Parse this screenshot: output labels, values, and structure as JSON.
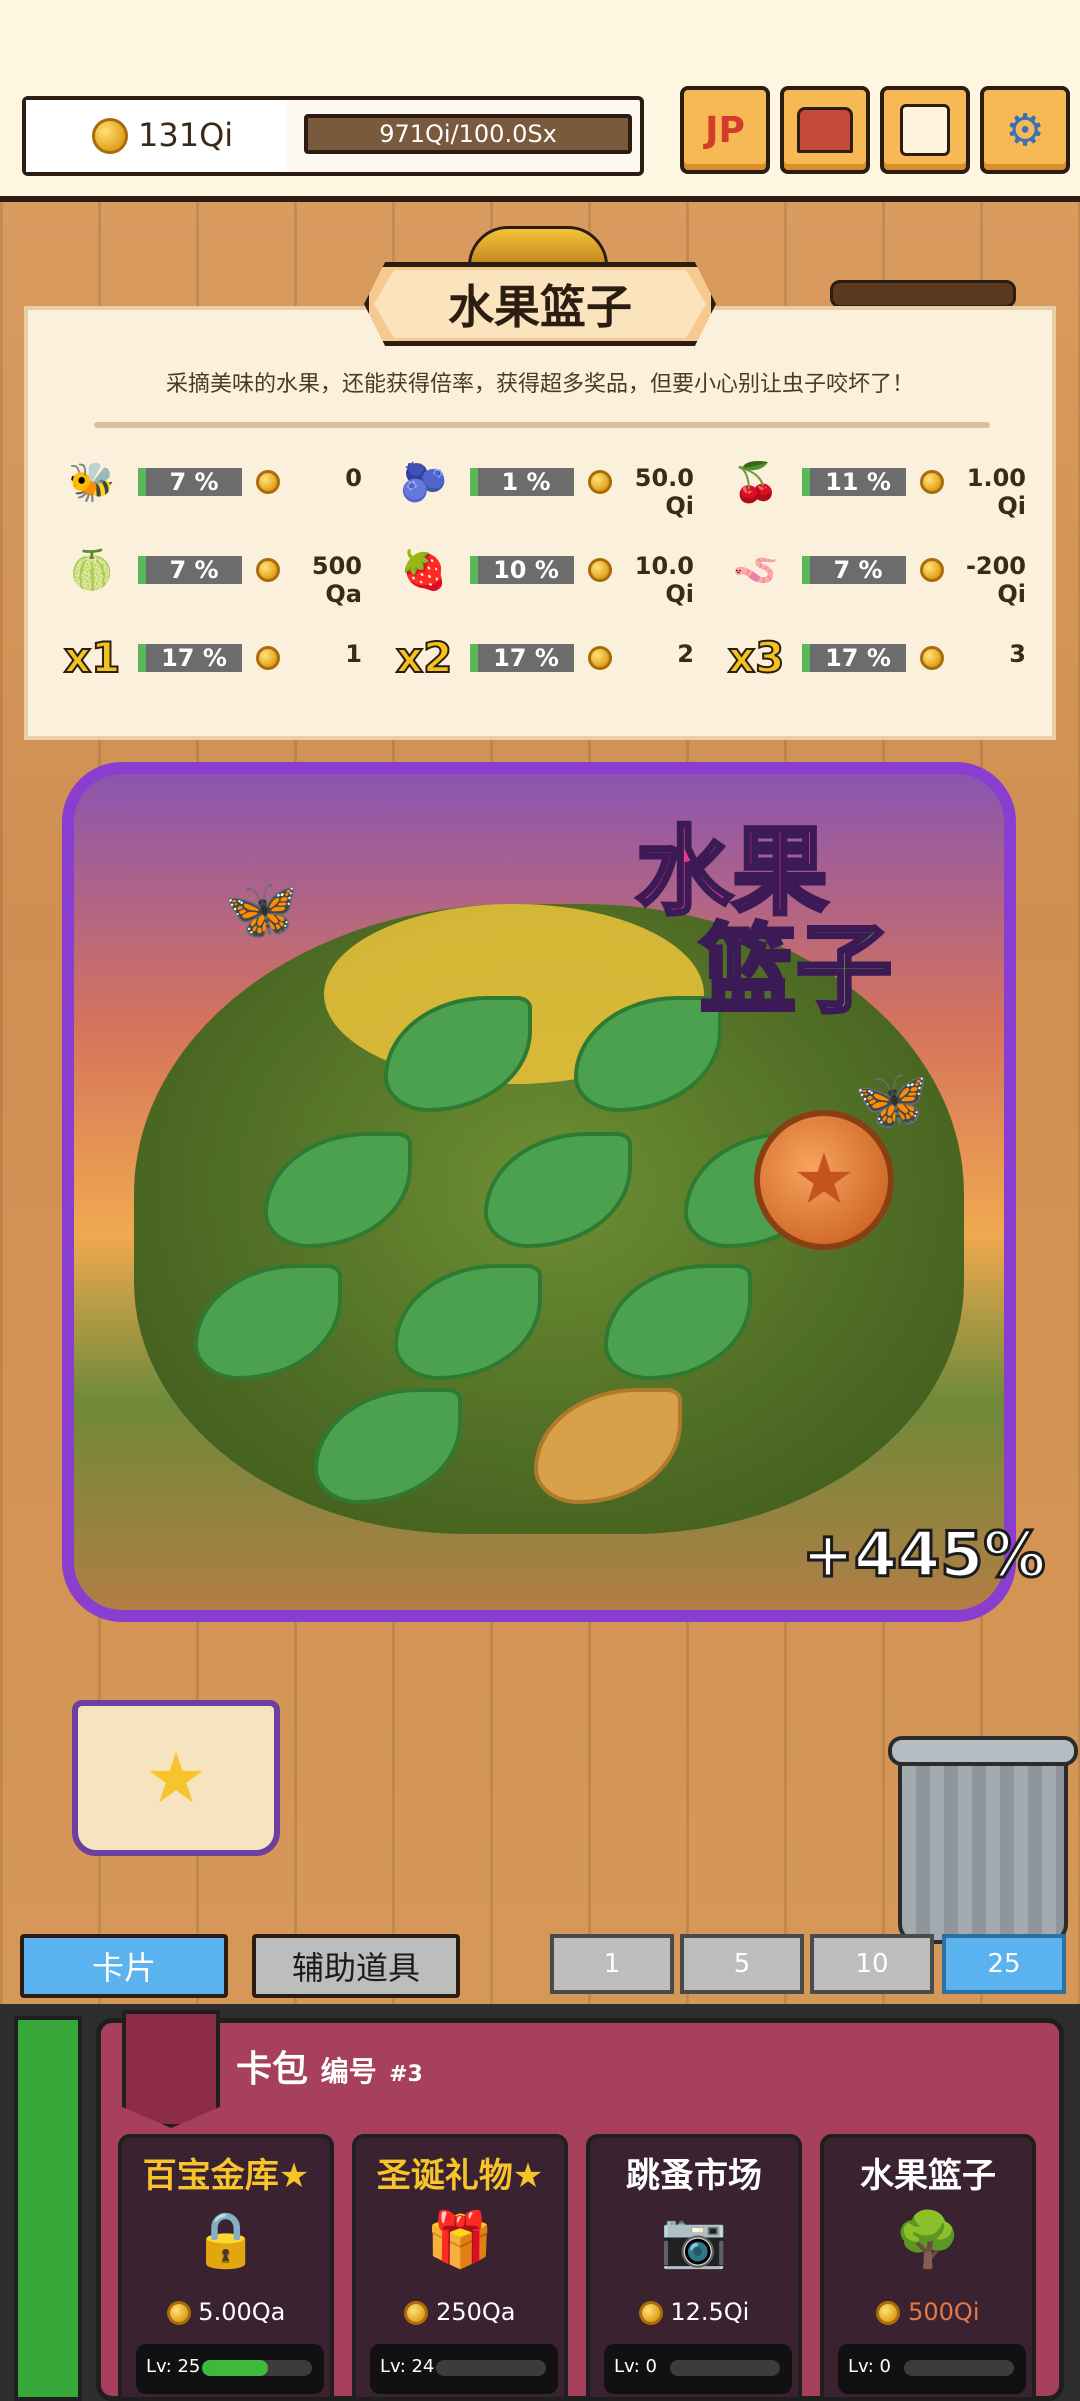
{
  "topbar": {
    "coins": "131Qi",
    "progress_text": "971Qi/100.0Sx",
    "buttons": [
      {
        "name": "jackpot-button",
        "label": "JP",
        "icon": "jp-icon"
      },
      {
        "name": "shop-button",
        "label": "",
        "icon": "treasure-chest-icon"
      },
      {
        "name": "quest-button",
        "label": "",
        "icon": "scroll-icon"
      },
      {
        "name": "settings-button",
        "label": "",
        "icon": "gear-icon"
      }
    ]
  },
  "game": {
    "title": "水果篮子",
    "description": "采摘美味的水果，还能获得倍率，获得超多奖品，但要小心别让虫子咬坏了！",
    "rewards": [
      {
        "icon": "bee-icon",
        "glyph": "🐝",
        "pct": "7 %",
        "value": "0"
      },
      {
        "icon": "blueberry-icon",
        "glyph": "🫐",
        "pct": "1 %",
        "value": "50.0 Qi"
      },
      {
        "icon": "cherry-icon",
        "glyph": "🍒",
        "pct": "11 %",
        "value": "1.00 Qi"
      },
      {
        "icon": "gooseberry-icon",
        "glyph": "🍈",
        "pct": "7 %",
        "value": "500 Qa"
      },
      {
        "icon": "strawberry-icon",
        "glyph": "🍓",
        "pct": "10 %",
        "value": "10.0 Qi"
      },
      {
        "icon": "worm-icon",
        "glyph": "🪱",
        "pct": "7 %",
        "value": "-200 Qi"
      },
      {
        "icon": "multiplier-x1-icon",
        "glyph": "x1",
        "pct": "17 %",
        "value": "1"
      },
      {
        "icon": "multiplier-x2-icon",
        "glyph": "x2",
        "pct": "17 %",
        "value": "2"
      },
      {
        "icon": "multiplier-x3-icon",
        "glyph": "x3",
        "pct": "17 %",
        "value": "3"
      }
    ],
    "logo_line1": "水果",
    "logo_line2": "篮子",
    "bonus": "+445%"
  },
  "tabs": {
    "cards": "卡片",
    "items": "辅助道具"
  },
  "quantities": [
    "1",
    "5",
    "10",
    "25"
  ],
  "active_quantity": "25",
  "pack": {
    "title": "卡包",
    "number_label": "编号",
    "number": "#3",
    "cards": [
      {
        "name": "百宝金库★",
        "icon": "vault-icon",
        "glyph": "🔒",
        "price": "5.00Qa",
        "level": "Lv: 25",
        "fill": 0.6,
        "color": "#f7c52b"
      },
      {
        "name": "圣诞礼物★",
        "icon": "gift-icon",
        "glyph": "🎁",
        "price": "250Qa",
        "level": "Lv: 24",
        "fill": 0.0,
        "color": "#f7c52b"
      },
      {
        "name": "跳蚤市场",
        "icon": "camera-icon",
        "glyph": "📷",
        "price": "12.5Qi",
        "level": "Lv: 0",
        "fill": 0.0,
        "color": "#ffffff"
      },
      {
        "name": "水果篮子",
        "icon": "bush-icon",
        "glyph": "🌳",
        "price": "500Qi",
        "level": "Lv: 0",
        "fill": 0.0,
        "color": "#ffffff"
      }
    ]
  }
}
